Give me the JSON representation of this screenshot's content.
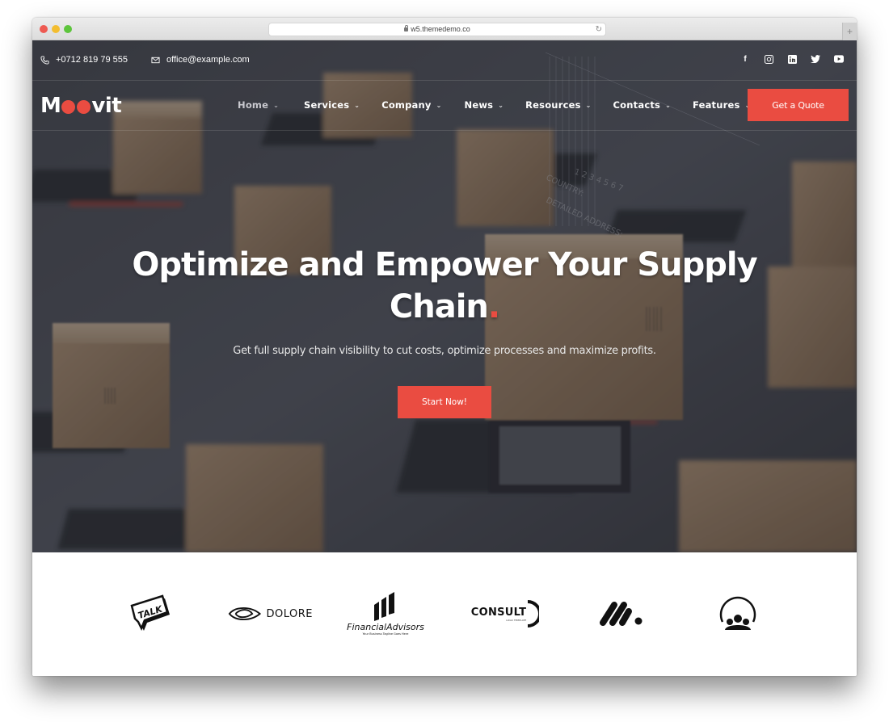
{
  "browser": {
    "url": "w5.themedemo.co",
    "icons": {
      "lock": "lock-icon",
      "reload": "reload-icon",
      "new_tab": "plus-icon"
    }
  },
  "topbar": {
    "phone": "+0712 819 79 555",
    "email": "office@example.com",
    "socials": [
      "facebook",
      "instagram",
      "linkedin",
      "twitter",
      "youtube"
    ],
    "social_glyphs": {
      "facebook": "f",
      "linkedin": "in"
    }
  },
  "nav": {
    "logo": {
      "pre": "M",
      "post": "vit"
    },
    "items": [
      {
        "label": "Home",
        "active": true
      },
      {
        "label": "Services",
        "active": false
      },
      {
        "label": "Company",
        "active": false
      },
      {
        "label": "News",
        "active": false
      },
      {
        "label": "Resources",
        "active": false
      },
      {
        "label": "Contacts",
        "active": false
      },
      {
        "label": "Features",
        "active": false
      }
    ],
    "chevron": "⌄",
    "cta": "Get a Quote"
  },
  "hero": {
    "headline_line1": "Optimize and Empower Your Supply",
    "headline_line2": "Chain",
    "headline_accent": ".",
    "subtitle": "Get full supply chain visibility to cut costs, optimize processes and maximize profits.",
    "cta": "Start Now!"
  },
  "clients": {
    "logos": [
      {
        "name": "talk",
        "text": "TALK"
      },
      {
        "name": "dolore",
        "text": "DOLORE"
      },
      {
        "name": "financial-advisors",
        "text_a": "Financial",
        "text_b": "Advisors",
        "tagline": "Your Business Tagline Goes Here"
      },
      {
        "name": "consult",
        "text": "CONSULT",
        "tagline": "LOGO TEMPLATE"
      },
      {
        "name": "m-mark",
        "text": ""
      },
      {
        "name": "community",
        "text": ""
      }
    ]
  },
  "colors": {
    "accent": "#ea4c41",
    "hero_overlay": "#1e2026",
    "text_light": "#ffffff"
  }
}
